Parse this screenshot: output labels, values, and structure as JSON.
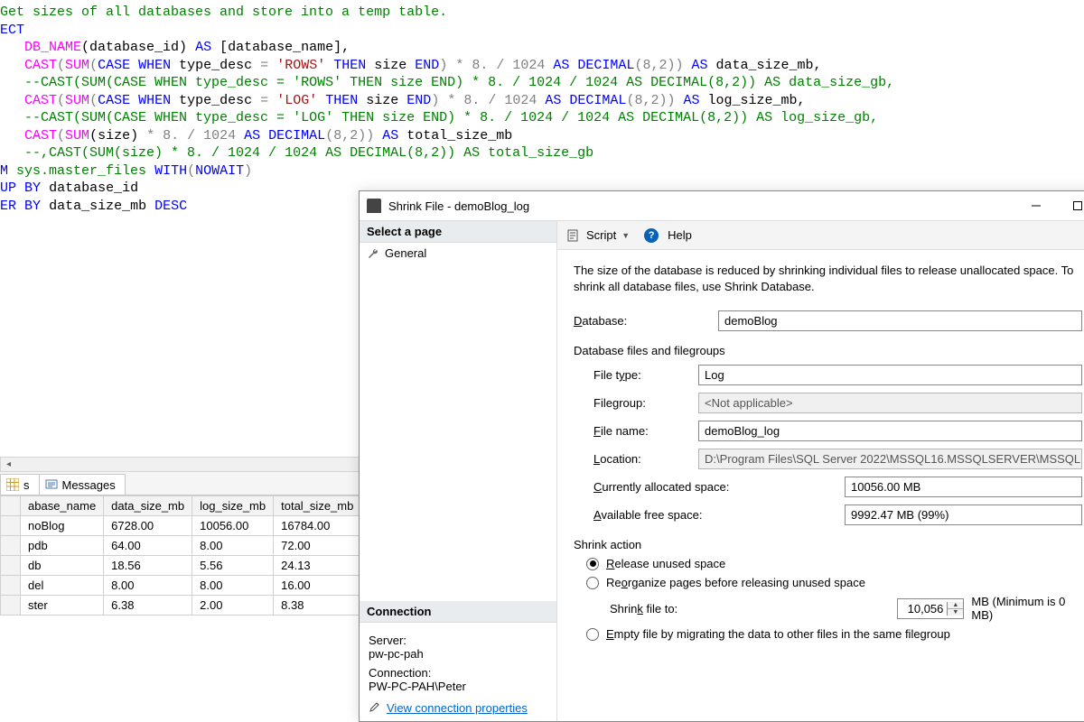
{
  "sql": {
    "l1": "Get sizes of all databases and store into a temp table.",
    "l2": "ECT",
    "l3a": "DB_NAME",
    "l3b": "(database_id)",
    "l3c": "AS",
    "l3d": "[database_name],",
    "l4a": "CAST",
    "l4b": "SUM",
    "l4c": "CASE",
    "l4d": "WHEN",
    "l4e": "type_desc",
    "l4f": "=",
    "l4g": "'ROWS'",
    "l4h": "THEN",
    "l4i": "size",
    "l4j": "END",
    "l4k": "* 8. / 1024",
    "l4l": "AS",
    "l4m": "DECIMAL",
    "l4n": "(8,2))",
    "l4o": "AS",
    "l4p": "data_size_mb,",
    "l5": "--CAST(SUM(CASE WHEN type_desc = 'ROWS' THEN size END) * 8. / 1024 / 1024 AS DECIMAL(8,2)) AS data_size_gb,",
    "l6g": "'LOG'",
    "l6p": "log_size_mb,",
    "l7": "--CAST(SUM(CASE WHEN type_desc = 'LOG' THEN size END) * 8. / 1024 / 1024 AS DECIMAL(8,2)) AS log_size_gb,",
    "l8a": "CAST",
    "l8b": "SUM",
    "l8c": "(size)",
    "l8d": "* 8. / 1024",
    "l8e": "AS",
    "l8f": "DECIMAL",
    "l8g": "(8,2))",
    "l8h": "AS",
    "l8i": "total_size_mb",
    "l9": "--,CAST(SUM(size) * 8. / 1024 / 1024 AS DECIMAL(8,2)) AS total_size_gb",
    "l10a": "M",
    "l10b": "sys.master_files",
    "l10c": "WITH",
    "l10d": "NOWAIT",
    "l11a": "UP",
    "l11b": "BY",
    "l11c": "database_id",
    "l12a": "ER",
    "l12b": "BY",
    "l12c": "data_size_mb",
    "l12d": "DESC"
  },
  "tabs": {
    "results_suffix": "s",
    "messages": "Messages"
  },
  "grid": {
    "headers": [
      "abase_name",
      "data_size_mb",
      "log_size_mb",
      "total_size_mb"
    ],
    "rows": [
      [
        "noBlog",
        "6728.00",
        "10056.00",
        "16784.00"
      ],
      [
        "pdb",
        "64.00",
        "8.00",
        "72.00"
      ],
      [
        "db",
        "18.56",
        "5.56",
        "24.13"
      ],
      [
        "del",
        "8.00",
        "8.00",
        "16.00"
      ],
      [
        "ster",
        "6.38",
        "2.00",
        "8.38"
      ]
    ]
  },
  "dialog": {
    "title": "Shrink File - demoBlog_log",
    "select_page": "Select a page",
    "general": "General",
    "script": "Script",
    "help": "Help",
    "desc": "The size of the database is reduced by shrinking individual files to release unallocated space. To shrink all database files, use Shrink Database.",
    "database_label": "Database:",
    "database_value": "demoBlog",
    "section_files": "Database files and filegroups",
    "filetype_label": "File type:",
    "filetype_value": "Log",
    "filegroup_label": "Filegroup:",
    "filegroup_value": "<Not applicable>",
    "filename_label": "File name:",
    "filename_value": "demoBlog_log",
    "location_label": "Location:",
    "location_value": "D:\\Program Files\\SQL Server 2022\\MSSQL16.MSSQLSERVER\\MSSQL",
    "alloc_label": "Currently allocated space:",
    "alloc_value": "10056.00 MB",
    "avail_label": "Available free space:",
    "avail_value": "9992.47 MB (99%)",
    "shrink_action": "Shrink action",
    "opt_release": "Release unused space",
    "opt_reorg": "Reorganize pages before releasing unused space",
    "shrink_file_to": "Shrink file to:",
    "shrink_value": "10,056",
    "shrink_unit": "MB (Minimum is 0 MB)",
    "opt_empty": "Empty file by migrating the data to other files in the same filegroup",
    "connection_head": "Connection",
    "server_label": "Server:",
    "server_value": "pw-pc-pah",
    "conn_label": "Connection:",
    "conn_value": "PW-PC-PAH\\Peter",
    "view_conn": "View connection properties"
  }
}
